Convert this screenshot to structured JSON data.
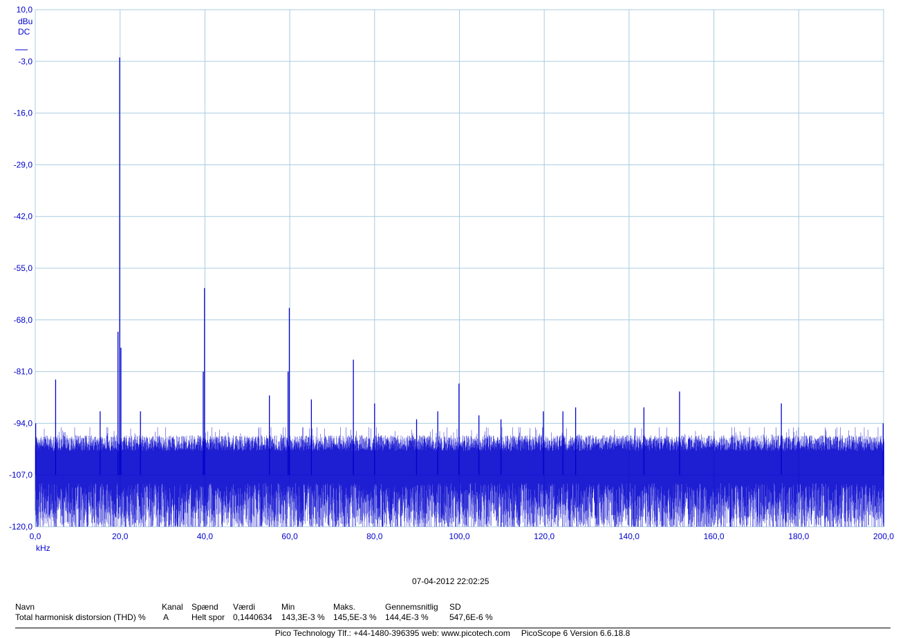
{
  "chart_data": {
    "type": "line",
    "title": "",
    "xlabel": "kHz",
    "ylabel_unit": "dBu",
    "ylabel_coupling": "DC",
    "xlim": [
      0,
      200
    ],
    "ylim": [
      -120,
      10
    ],
    "grid": true,
    "series_color": "#0000cc",
    "grid_color": "#a8cce0",
    "y_tick_labels": [
      "10,0",
      "-3,0",
      "-16,0",
      "-29,0",
      "-42,0",
      "-55,0",
      "-68,0",
      "-81,0",
      "-94,0",
      "-107,0",
      "-120,0"
    ],
    "y_tick_values": [
      10,
      -3,
      -16,
      -29,
      -42,
      -55,
      -68,
      -81,
      -94,
      -107,
      -120
    ],
    "x_tick_labels": [
      "0,0",
      "20,0",
      "40,0",
      "60,0",
      "80,0",
      "100,0",
      "120,0",
      "140,0",
      "160,0",
      "180,0",
      "200,0"
    ],
    "x_tick_values": [
      0,
      20,
      40,
      60,
      80,
      100,
      120,
      140,
      160,
      180,
      200
    ],
    "noise_floor": {
      "center_dBu": -107,
      "top_dBu": -97,
      "bottom_dBu": -120
    },
    "series": [
      {
        "values": [
          {
            "x": 0.1,
            "y": -94
          },
          {
            "x": 4.8,
            "y": -83
          },
          {
            "x": 15.3,
            "y": -91
          },
          {
            "x": 19.5,
            "y": -71
          },
          {
            "x": 19.9,
            "y": -2
          },
          {
            "x": 20.2,
            "y": -75
          },
          {
            "x": 24.8,
            "y": -91
          },
          {
            "x": 39.6,
            "y": -81
          },
          {
            "x": 39.9,
            "y": -60
          },
          {
            "x": 55.2,
            "y": -87
          },
          {
            "x": 59.6,
            "y": -81
          },
          {
            "x": 59.9,
            "y": -65
          },
          {
            "x": 65.1,
            "y": -88
          },
          {
            "x": 75.0,
            "y": -78
          },
          {
            "x": 80.0,
            "y": -89
          },
          {
            "x": 89.9,
            "y": -93
          },
          {
            "x": 94.9,
            "y": -91
          },
          {
            "x": 99.9,
            "y": -84
          },
          {
            "x": 104.6,
            "y": -92
          },
          {
            "x": 109.8,
            "y": -93
          },
          {
            "x": 119.8,
            "y": -91
          },
          {
            "x": 124.4,
            "y": -91
          },
          {
            "x": 127.4,
            "y": -90
          },
          {
            "x": 143.5,
            "y": -90
          },
          {
            "x": 151.9,
            "y": -86
          },
          {
            "x": 175.9,
            "y": -89
          },
          {
            "x": 199.9,
            "y": -94
          }
        ]
      }
    ]
  },
  "timestamp": "07-04-2012 22:02:25",
  "measurements": {
    "headers": [
      "Navn",
      "Kanal",
      "Spænd",
      "Værdi",
      "Min",
      "Maks.",
      "Gennemsnitlig",
      "SD"
    ],
    "row": [
      "Total harmonisk distorsion (THD) %",
      "A",
      "Helt spor",
      "0,1440634",
      "143,3E-3 %",
      "145,5E-3 %",
      "144,4E-3 %",
      "547,6E-6 %"
    ]
  },
  "footer": {
    "company": "Pico Technology Tlf.: +44-1480-396395  web: www.picotech.com",
    "version": "PicoScope 6 Version 6.6.18.8"
  }
}
